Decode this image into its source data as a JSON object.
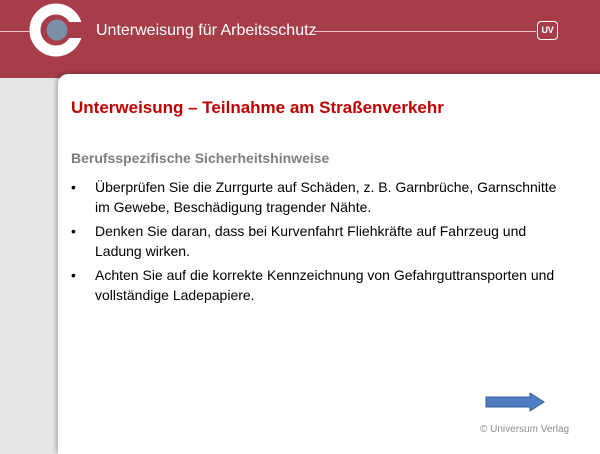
{
  "header": {
    "title": "Unterweisung für Arbeitsschutz",
    "logo_icon": "circle-logo-icon",
    "badge": "UV",
    "color": "#a63d48"
  },
  "slide": {
    "title": "Unterweisung – Teilnahme am Straßenverkehr",
    "subtitle": "Berufsspezifische Sicherheitshinweise",
    "bullet_symbol": "•",
    "bullets": [
      "Überprüfen Sie die Zurrgurte auf Schäden, z. B. Garnbrüche, Garnschnitte im Gewebe, Beschädigung tragender Nähte.",
      "Denken Sie daran, dass bei Kurvenfahrt Fliehkräfte auf Fahrzeug und Ladung wirken.",
      "Achten Sie auf die korrekte Kennzeichnung von Gefahrguttransporten und vollständige Ladepapiere."
    ],
    "next_icon": "arrow-right-icon",
    "copyright": "© Universum Verlag",
    "title_color": "#c00000",
    "subtitle_color": "#7f7f7f",
    "arrow_color": "#4f7ec4"
  }
}
